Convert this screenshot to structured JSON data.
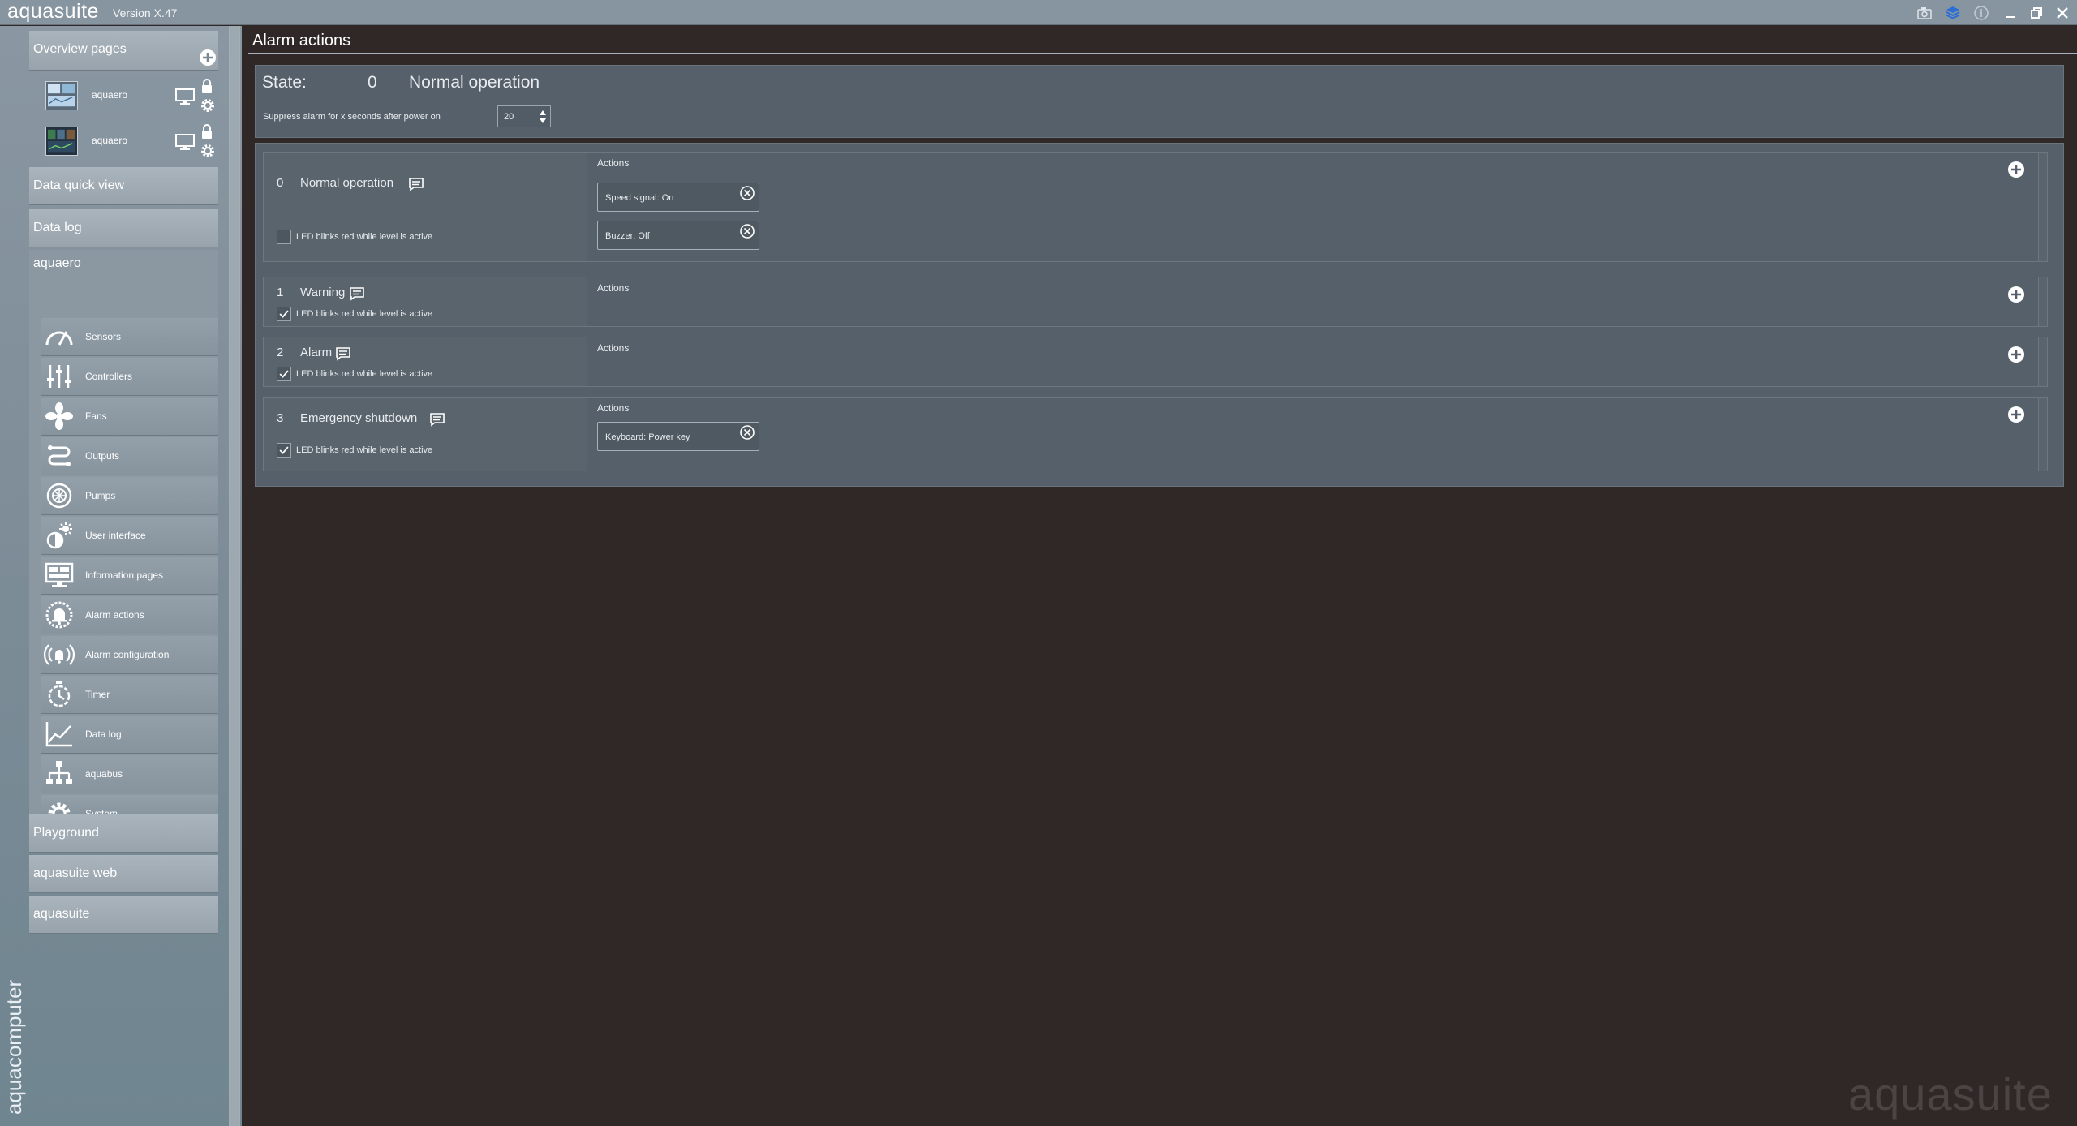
{
  "app": {
    "name": "aquasuite",
    "version": "Version X.47"
  },
  "titlebar": {
    "icons": [
      "camera-icon",
      "layers-icon",
      "info-icon",
      "minimize-icon",
      "restore-icon",
      "close-icon"
    ]
  },
  "sidebar": {
    "overview_title": "Overview pages",
    "overview_items": [
      {
        "label": "aquaero"
      },
      {
        "label": "aquaero"
      }
    ],
    "data_quick_view": "Data quick view",
    "data_log": "Data log",
    "aquaero_title": "aquaero",
    "aquaero_items": [
      {
        "label": "Sensors",
        "icon": "gauge-icon"
      },
      {
        "label": "Controllers",
        "icon": "sliders-icon"
      },
      {
        "label": "Fans",
        "icon": "fan-icon"
      },
      {
        "label": "Outputs",
        "icon": "outputs-icon"
      },
      {
        "label": "Pumps",
        "icon": "pump-icon"
      },
      {
        "label": "User interface",
        "icon": "brightness-icon"
      },
      {
        "label": "Information pages",
        "icon": "display-icon"
      },
      {
        "label": "Alarm actions",
        "icon": "alarm-bell-icon"
      },
      {
        "label": "Alarm configuration",
        "icon": "alarm-config-icon"
      },
      {
        "label": "Timer",
        "icon": "timer-icon"
      },
      {
        "label": "Data log",
        "icon": "chart-icon"
      },
      {
        "label": "aquabus",
        "icon": "network-icon"
      },
      {
        "label": "System",
        "icon": "gear-icon"
      }
    ],
    "playground": "Playground",
    "aquasuite_web": "aquasuite web",
    "aquasuite": "aquasuite",
    "brand": "aquacomputer"
  },
  "main": {
    "title": "Alarm actions",
    "state": {
      "label": "State:",
      "value": "0",
      "text": "Normal operation"
    },
    "suppress": {
      "label": "Suppress alarm for x seconds after power on",
      "value": "20"
    },
    "actions_label": "Actions",
    "led_label": "LED blinks red while level is active",
    "levels": [
      {
        "number": "0",
        "name": "Normal operation",
        "led_checked": false,
        "actions": [
          "Speed signal: On",
          "Buzzer: Off"
        ]
      },
      {
        "number": "1",
        "name": "Warning",
        "led_checked": true,
        "actions": []
      },
      {
        "number": "2",
        "name": "Alarm",
        "led_checked": true,
        "actions": []
      },
      {
        "number": "3",
        "name": "Emergency shutdown",
        "led_checked": true,
        "actions": [
          "Keyboard: Power key"
        ]
      }
    ]
  },
  "watermark": "aquasuite"
}
